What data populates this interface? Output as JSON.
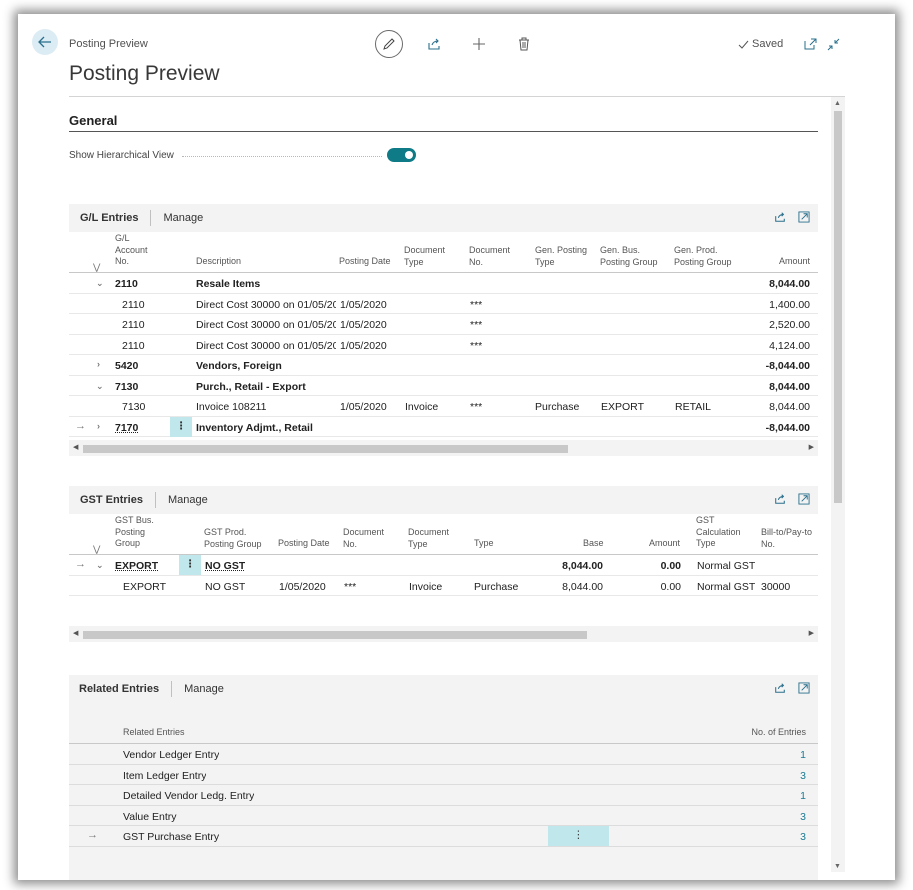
{
  "header": {
    "breadcrumb": "Posting Preview",
    "title": "Posting Preview",
    "saved_label": "Saved"
  },
  "general": {
    "title": "General",
    "show_hierarchical_label": "Show Hierarchical View",
    "show_hierarchical_on": true
  },
  "gl_entries": {
    "title": "G/L Entries",
    "manage": "Manage",
    "columns": {
      "account_no": [
        "G/L",
        "Account",
        "No."
      ],
      "description": "Description",
      "posting_date": "Posting Date",
      "document_type": [
        "Document",
        "Type"
      ],
      "document_no": [
        "Document",
        "No."
      ],
      "gen_posting_type": [
        "Gen. Posting",
        "Type"
      ],
      "gen_bus_posting_group": [
        "Gen. Bus.",
        "Posting Group"
      ],
      "gen_prod_posting_group": [
        "Gen. Prod.",
        "Posting Group"
      ],
      "amount": "Amount"
    },
    "rows": [
      {
        "account": "2110",
        "description": "Resale Items",
        "date": "",
        "doc_type": "",
        "doc_no": "",
        "gen_type": "",
        "bus_group": "",
        "prod_group": "",
        "amount": "8,044.00"
      },
      {
        "account": "2110",
        "description": "Direct Cost 30000 on 01/05/20",
        "date": "1/05/2020",
        "doc_type": "",
        "doc_no": "***",
        "gen_type": "",
        "bus_group": "",
        "prod_group": "",
        "amount": "1,400.00"
      },
      {
        "account": "2110",
        "description": "Direct Cost 30000 on 01/05/20",
        "date": "1/05/2020",
        "doc_type": "",
        "doc_no": "***",
        "gen_type": "",
        "bus_group": "",
        "prod_group": "",
        "amount": "2,520.00"
      },
      {
        "account": "2110",
        "description": "Direct Cost 30000 on 01/05/20",
        "date": "1/05/2020",
        "doc_type": "",
        "doc_no": "***",
        "gen_type": "",
        "bus_group": "",
        "prod_group": "",
        "amount": "4,124.00"
      },
      {
        "account": "5420",
        "description": "Vendors, Foreign",
        "date": "",
        "doc_type": "",
        "doc_no": "",
        "gen_type": "",
        "bus_group": "",
        "prod_group": "",
        "amount": "-8,044.00"
      },
      {
        "account": "7130",
        "description": "Purch., Retail - Export",
        "date": "",
        "doc_type": "",
        "doc_no": "",
        "gen_type": "",
        "bus_group": "",
        "prod_group": "",
        "amount": "8,044.00"
      },
      {
        "account": "7130",
        "description": "Invoice 108211",
        "date": "1/05/2020",
        "doc_type": "Invoice",
        "doc_no": "***",
        "gen_type": "Purchase",
        "bus_group": "EXPORT",
        "prod_group": "RETAIL",
        "amount": "8,044.00"
      },
      {
        "account": "7170",
        "description": "Inventory Adjmt., Retail",
        "date": "",
        "doc_type": "",
        "doc_no": "",
        "gen_type": "",
        "bus_group": "",
        "prod_group": "",
        "amount": "-8,044.00"
      }
    ]
  },
  "gst_entries": {
    "title": "GST Entries",
    "manage": "Manage",
    "columns": {
      "bus_group": [
        "GST Bus.",
        "Posting",
        "Group"
      ],
      "prod_group": [
        "GST Prod.",
        "Posting Group"
      ],
      "posting_date": "Posting Date",
      "document_no": [
        "Document",
        "No."
      ],
      "document_type": [
        "Document",
        "Type"
      ],
      "type": "Type",
      "base": "Base",
      "amount": "Amount",
      "calc_type": [
        "GST",
        "Calculation",
        "Type"
      ],
      "bill_to": [
        "Bill-to/Pay-to",
        "No."
      ]
    },
    "rows": [
      {
        "bus_group": "EXPORT",
        "prod_group": "NO GST",
        "date": "",
        "doc_no": "",
        "doc_type": "",
        "type": "",
        "base": "8,044.00",
        "amount": "0.00",
        "calc_type": "Normal GST",
        "bill_to": ""
      },
      {
        "bus_group": "EXPORT",
        "prod_group": "NO GST",
        "date": "1/05/2020",
        "doc_no": "***",
        "doc_type": "Invoice",
        "type": "Purchase",
        "base": "8,044.00",
        "amount": "0.00",
        "calc_type": "Normal GST",
        "bill_to": "30000"
      }
    ]
  },
  "related_entries": {
    "title": "Related Entries",
    "manage": "Manage",
    "col_name": "Related Entries",
    "col_count": "No. of Entries",
    "rows": [
      {
        "name": "Vendor Ledger Entry",
        "count": "1"
      },
      {
        "name": "Item Ledger Entry",
        "count": "3"
      },
      {
        "name": "Detailed Vendor Ledg. Entry",
        "count": "1"
      },
      {
        "name": "Value Entry",
        "count": "3"
      },
      {
        "name": "GST Purchase Entry",
        "count": "3"
      }
    ]
  },
  "colors": {
    "accent": "#0f7b86",
    "selection": "#bfe7ec",
    "link": "#1a7a94"
  }
}
